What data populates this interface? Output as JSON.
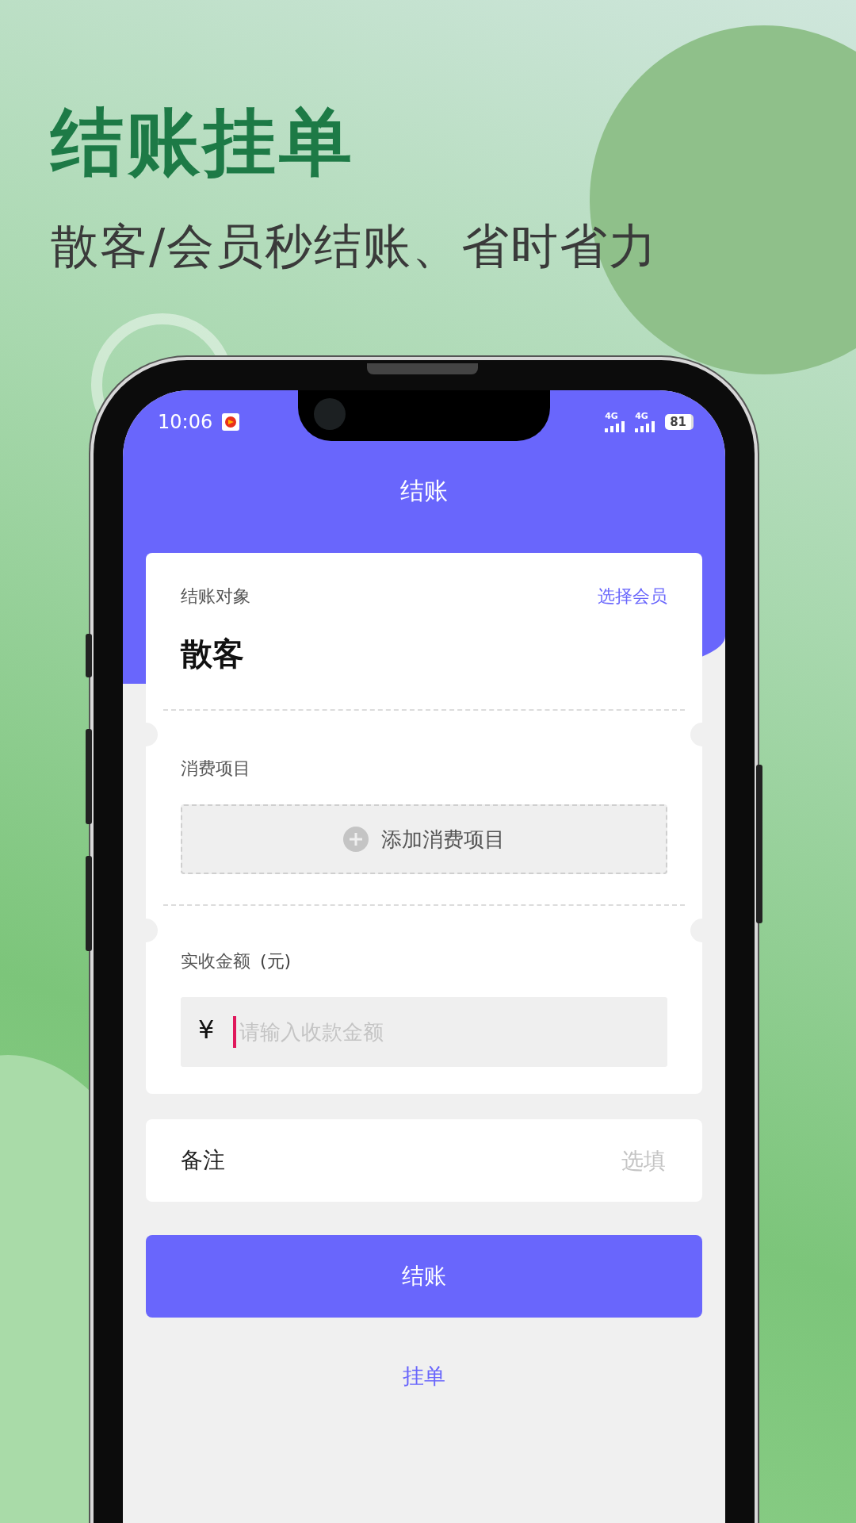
{
  "headline": "结账挂单",
  "subheadline": "散客/会员秒结账、省时省力",
  "status_bar": {
    "time": "10:06",
    "network_1": "4G",
    "network_2": "4G",
    "battery": "81"
  },
  "header": {
    "title": "结账"
  },
  "checkout_target": {
    "label": "结账对象",
    "link": "选择会员",
    "value": "散客"
  },
  "items": {
    "label": "消费项目",
    "add_button": "添加消费项目"
  },
  "amount": {
    "label": "实收金额",
    "unit": "(元)",
    "currency": "¥",
    "placeholder": "请输入收款金额"
  },
  "remark": {
    "label": "备注",
    "placeholder": "选填"
  },
  "primary_button": "结账",
  "secondary_link": "挂单"
}
